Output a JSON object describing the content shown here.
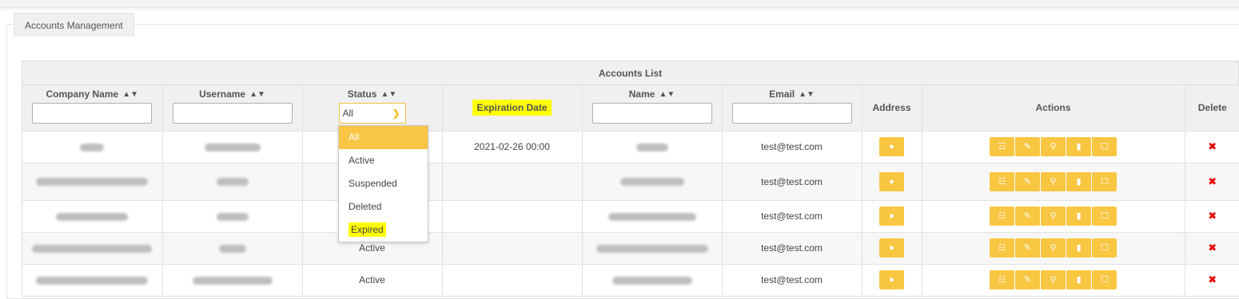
{
  "panel": {
    "tab_label": "Accounts Management"
  },
  "list": {
    "title": "Accounts List",
    "columns": {
      "company": "Company Name",
      "username": "Username",
      "status": "Status",
      "expiration": "Expiration Date",
      "name": "Name",
      "email": "Email",
      "address": "Address",
      "actions": "Actions",
      "delete": "Delete"
    },
    "sort_icon": "⬍",
    "status_filter": {
      "value": "All"
    },
    "rows": [
      {
        "status": "",
        "expiration": "2021-02-26 00:00",
        "email": "test@test.com"
      },
      {
        "status": "",
        "expiration": "",
        "email": "test@test.com"
      },
      {
        "status": "",
        "expiration": "",
        "email": "test@test.com"
      },
      {
        "status": "Active",
        "expiration": "",
        "email": "test@test.com"
      },
      {
        "status": "Active",
        "expiration": "",
        "email": "test@test.com"
      }
    ]
  },
  "dropdown": {
    "options": [
      "All",
      "Active",
      "Suspended",
      "Deleted",
      "Expired"
    ],
    "selected": "All"
  },
  "icons": {
    "address": "map-marker-icon",
    "actions": [
      "id-card-icon",
      "edit-icon",
      "key-icon",
      "mobile-icon",
      "unlock-icon"
    ],
    "delete": "close-icon"
  },
  "colors": {
    "accent": "#f9c642",
    "highlight": "#ffff00",
    "delete": "#e60000"
  }
}
